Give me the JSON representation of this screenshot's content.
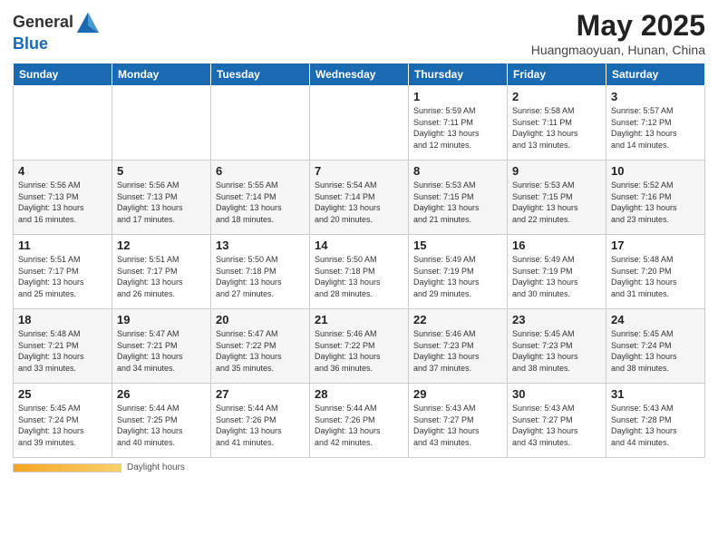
{
  "header": {
    "logo_line1": "General",
    "logo_line2": "Blue",
    "title": "May 2025",
    "subtitle": "Huangmaoyuan, Hunan, China"
  },
  "days_of_week": [
    "Sunday",
    "Monday",
    "Tuesday",
    "Wednesday",
    "Thursday",
    "Friday",
    "Saturday"
  ],
  "weeks": [
    [
      {
        "num": "",
        "info": ""
      },
      {
        "num": "",
        "info": ""
      },
      {
        "num": "",
        "info": ""
      },
      {
        "num": "",
        "info": ""
      },
      {
        "num": "1",
        "info": "Sunrise: 5:59 AM\nSunset: 7:11 PM\nDaylight: 13 hours\nand 12 minutes."
      },
      {
        "num": "2",
        "info": "Sunrise: 5:58 AM\nSunset: 7:11 PM\nDaylight: 13 hours\nand 13 minutes."
      },
      {
        "num": "3",
        "info": "Sunrise: 5:57 AM\nSunset: 7:12 PM\nDaylight: 13 hours\nand 14 minutes."
      }
    ],
    [
      {
        "num": "4",
        "info": "Sunrise: 5:56 AM\nSunset: 7:13 PM\nDaylight: 13 hours\nand 16 minutes."
      },
      {
        "num": "5",
        "info": "Sunrise: 5:56 AM\nSunset: 7:13 PM\nDaylight: 13 hours\nand 17 minutes."
      },
      {
        "num": "6",
        "info": "Sunrise: 5:55 AM\nSunset: 7:14 PM\nDaylight: 13 hours\nand 18 minutes."
      },
      {
        "num": "7",
        "info": "Sunrise: 5:54 AM\nSunset: 7:14 PM\nDaylight: 13 hours\nand 20 minutes."
      },
      {
        "num": "8",
        "info": "Sunrise: 5:53 AM\nSunset: 7:15 PM\nDaylight: 13 hours\nand 21 minutes."
      },
      {
        "num": "9",
        "info": "Sunrise: 5:53 AM\nSunset: 7:15 PM\nDaylight: 13 hours\nand 22 minutes."
      },
      {
        "num": "10",
        "info": "Sunrise: 5:52 AM\nSunset: 7:16 PM\nDaylight: 13 hours\nand 23 minutes."
      }
    ],
    [
      {
        "num": "11",
        "info": "Sunrise: 5:51 AM\nSunset: 7:17 PM\nDaylight: 13 hours\nand 25 minutes."
      },
      {
        "num": "12",
        "info": "Sunrise: 5:51 AM\nSunset: 7:17 PM\nDaylight: 13 hours\nand 26 minutes."
      },
      {
        "num": "13",
        "info": "Sunrise: 5:50 AM\nSunset: 7:18 PM\nDaylight: 13 hours\nand 27 minutes."
      },
      {
        "num": "14",
        "info": "Sunrise: 5:50 AM\nSunset: 7:18 PM\nDaylight: 13 hours\nand 28 minutes."
      },
      {
        "num": "15",
        "info": "Sunrise: 5:49 AM\nSunset: 7:19 PM\nDaylight: 13 hours\nand 29 minutes."
      },
      {
        "num": "16",
        "info": "Sunrise: 5:49 AM\nSunset: 7:19 PM\nDaylight: 13 hours\nand 30 minutes."
      },
      {
        "num": "17",
        "info": "Sunrise: 5:48 AM\nSunset: 7:20 PM\nDaylight: 13 hours\nand 31 minutes."
      }
    ],
    [
      {
        "num": "18",
        "info": "Sunrise: 5:48 AM\nSunset: 7:21 PM\nDaylight: 13 hours\nand 33 minutes."
      },
      {
        "num": "19",
        "info": "Sunrise: 5:47 AM\nSunset: 7:21 PM\nDaylight: 13 hours\nand 34 minutes."
      },
      {
        "num": "20",
        "info": "Sunrise: 5:47 AM\nSunset: 7:22 PM\nDaylight: 13 hours\nand 35 minutes."
      },
      {
        "num": "21",
        "info": "Sunrise: 5:46 AM\nSunset: 7:22 PM\nDaylight: 13 hours\nand 36 minutes."
      },
      {
        "num": "22",
        "info": "Sunrise: 5:46 AM\nSunset: 7:23 PM\nDaylight: 13 hours\nand 37 minutes."
      },
      {
        "num": "23",
        "info": "Sunrise: 5:45 AM\nSunset: 7:23 PM\nDaylight: 13 hours\nand 38 minutes."
      },
      {
        "num": "24",
        "info": "Sunrise: 5:45 AM\nSunset: 7:24 PM\nDaylight: 13 hours\nand 38 minutes."
      }
    ],
    [
      {
        "num": "25",
        "info": "Sunrise: 5:45 AM\nSunset: 7:24 PM\nDaylight: 13 hours\nand 39 minutes."
      },
      {
        "num": "26",
        "info": "Sunrise: 5:44 AM\nSunset: 7:25 PM\nDaylight: 13 hours\nand 40 minutes."
      },
      {
        "num": "27",
        "info": "Sunrise: 5:44 AM\nSunset: 7:26 PM\nDaylight: 13 hours\nand 41 minutes."
      },
      {
        "num": "28",
        "info": "Sunrise: 5:44 AM\nSunset: 7:26 PM\nDaylight: 13 hours\nand 42 minutes."
      },
      {
        "num": "29",
        "info": "Sunrise: 5:43 AM\nSunset: 7:27 PM\nDaylight: 13 hours\nand 43 minutes."
      },
      {
        "num": "30",
        "info": "Sunrise: 5:43 AM\nSunset: 7:27 PM\nDaylight: 13 hours\nand 43 minutes."
      },
      {
        "num": "31",
        "info": "Sunrise: 5:43 AM\nSunset: 7:28 PM\nDaylight: 13 hours\nand 44 minutes."
      }
    ]
  ],
  "footer": {
    "daylight_label": "Daylight hours"
  }
}
